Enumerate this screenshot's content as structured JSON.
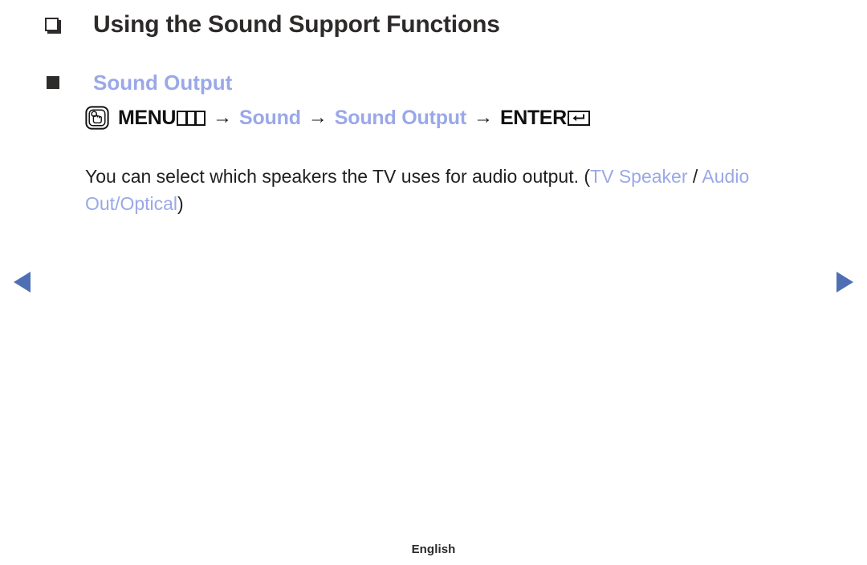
{
  "heading": {
    "bullet_icon": "hollow-square-bullet-icon",
    "title": "Using the Sound Support Functions"
  },
  "section": {
    "bullet_icon": "filled-square-bullet-icon",
    "title": "Sound Output"
  },
  "menu_path": {
    "remote_icon": "remote-button-press-icon",
    "menu_label": "MENU",
    "menu_glyph_icon": "menu-columns-icon",
    "arrow": "→",
    "step_sound": "Sound",
    "step_sound_output": "Sound Output",
    "enter_label": "ENTER",
    "enter_glyph_icon": "enter-return-arrow-icon"
  },
  "description": {
    "part1": "You can select which speakers the TV uses for audio output. (",
    "option1": "TV Speaker",
    "separator": " / ",
    "option2": "Audio Out/Optical",
    "part2": ")"
  },
  "navigation": {
    "prev_icon": "prev-arrow-icon",
    "next_icon": "next-arrow-icon"
  },
  "footer": {
    "language": "English"
  },
  "colors": {
    "accent": "#9aa8e8",
    "nav_arrow": "#4f6fb5",
    "text": "#222020",
    "heading": "#2d2a2a"
  }
}
